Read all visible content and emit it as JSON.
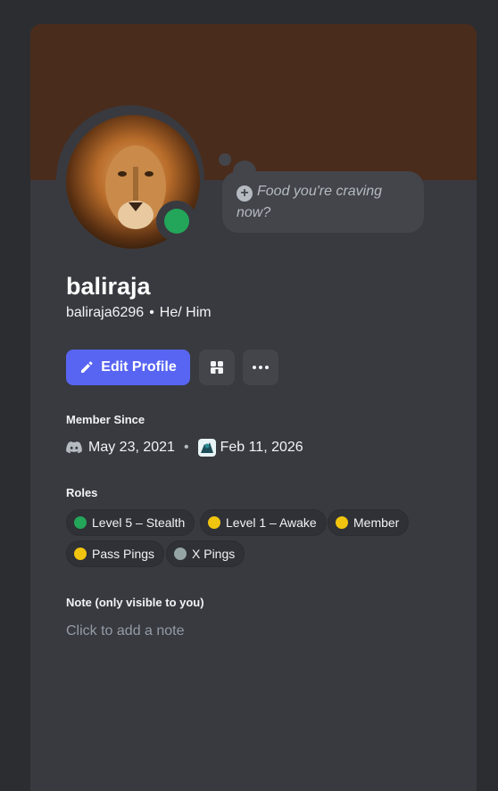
{
  "profile": {
    "display_name": "baliraja",
    "username": "baliraja6296",
    "pronouns": "He/ Him",
    "status": "online"
  },
  "colors": {
    "banner": "#4a2c1c",
    "accent": "#5865f2",
    "online": "#23a55a"
  },
  "status_bubble": {
    "placeholder": "Food you're craving now?"
  },
  "actions": {
    "edit_profile_label": "Edit Profile",
    "icons": [
      "pencil-icon",
      "nitro-shop-icon",
      "more-options-icon"
    ]
  },
  "member_since": {
    "title": "Member Since",
    "discord_date": "May 23, 2021",
    "server_date": "Feb 11, 2026"
  },
  "roles": {
    "title": "Roles",
    "items": [
      {
        "label": "Level 5 – Stealth",
        "color": "#23a55a"
      },
      {
        "label": "Level 1 – Awake",
        "color": "#f1c40f"
      },
      {
        "label": "Member",
        "color": "#f1c40f"
      },
      {
        "label": "Pass Pings",
        "color": "#f1c40f"
      },
      {
        "label": "X Pings",
        "color": "#95a5a6"
      }
    ]
  },
  "note": {
    "title": "Note (only visible to you)",
    "placeholder": "Click to add a note"
  }
}
